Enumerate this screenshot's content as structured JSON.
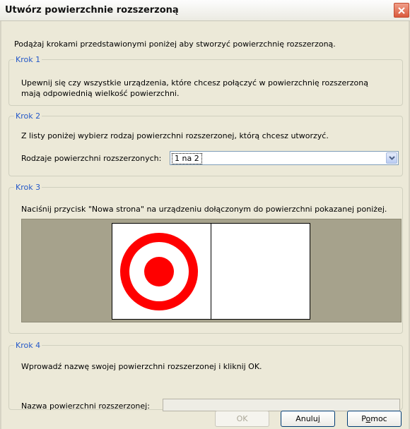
{
  "window": {
    "title": "Utwórz powierzchnie rozszerzoną"
  },
  "intro": "Podążaj krokami przedstawionymi poniżej aby stworzyć powierzchnię rozszerzoną.",
  "step1": {
    "legend": "Krok 1",
    "text_line1": "Upewnij się czy wszystkie urządzenia, które chcesz połączyć w powierzchnię rozszerzoną",
    "text_line2": "mają odpowiednią wielkość powierzchni."
  },
  "step2": {
    "legend": "Krok 2",
    "text": "Z listy poniżej wybierz rodzaj powierzchni rozszerzonej, którą chcesz utworzyć.",
    "combo_label": "Rodzaje powierzchni rozszerzonych:",
    "combo_value": "1 na 2"
  },
  "step3": {
    "legend": "Krok 3",
    "text": "Naciśnij przycisk \"Nowa strona\" na urządzeniu dołączonym do powierzchni pokazanej poniżej.",
    "target_color": "#ff0000",
    "preview_background": "#a6a28c"
  },
  "step4": {
    "legend": "Krok 4",
    "text": "Wprowadź nazwę swojej powierzchni rozszerzonej i kliknij OK.",
    "name_label": "Nazwa powierzchni rozszerzonej:",
    "name_value": ""
  },
  "buttons": {
    "ok": "OK",
    "cancel_prefix": "Anulu",
    "cancel_accel": "j",
    "help_prefix": "P",
    "help_accel": "o",
    "help_suffix": "moc"
  }
}
